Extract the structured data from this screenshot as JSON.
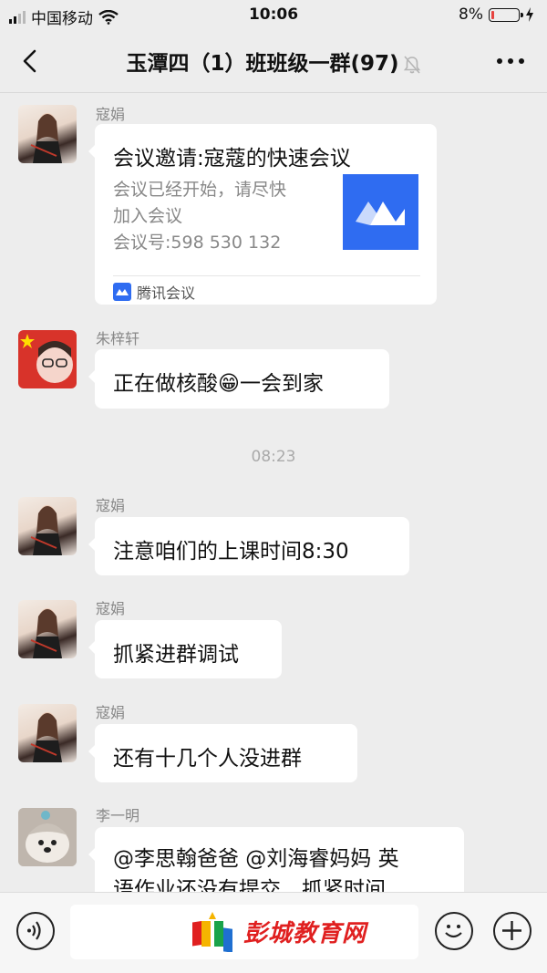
{
  "status_bar": {
    "carrier": "中国移动",
    "time": "10:06",
    "battery": "8%"
  },
  "chat": {
    "title": "玉潭四（1）班班级一群(97)"
  },
  "messages": [
    {
      "sender": "寇娟",
      "type": "meeting-card",
      "card": {
        "title": "会议邀请:寇蔻的快速会议",
        "desc_line1": "会议已经开始，请尽快",
        "desc_line2": "加入会议",
        "meeting_no": "会议号:598 530 132",
        "source": "腾讯会议"
      }
    },
    {
      "sender": "朱梓轩",
      "text_before": "正在做核酸",
      "emoji": "😁",
      "text_after": "一会到家"
    },
    {
      "sender": "寇娟",
      "text": "注意咱们的上课时间8:30"
    },
    {
      "sender": "寇娟",
      "text": "抓紧进群调试"
    },
    {
      "sender": "寇娟",
      "text": "还有十几个人没进群"
    },
    {
      "sender": "李一明",
      "line1": "@李思翰爸爸 @刘海睿妈妈 英",
      "line2": "语作业还没有提交，抓紧时间"
    }
  ],
  "timestamp": "08:23",
  "watermark": "彭城教育网",
  "colors": {
    "background": "#ededed",
    "bubble": "#ffffff",
    "meeting_brand": "#2f6cf1",
    "watermark": "#e02020"
  }
}
